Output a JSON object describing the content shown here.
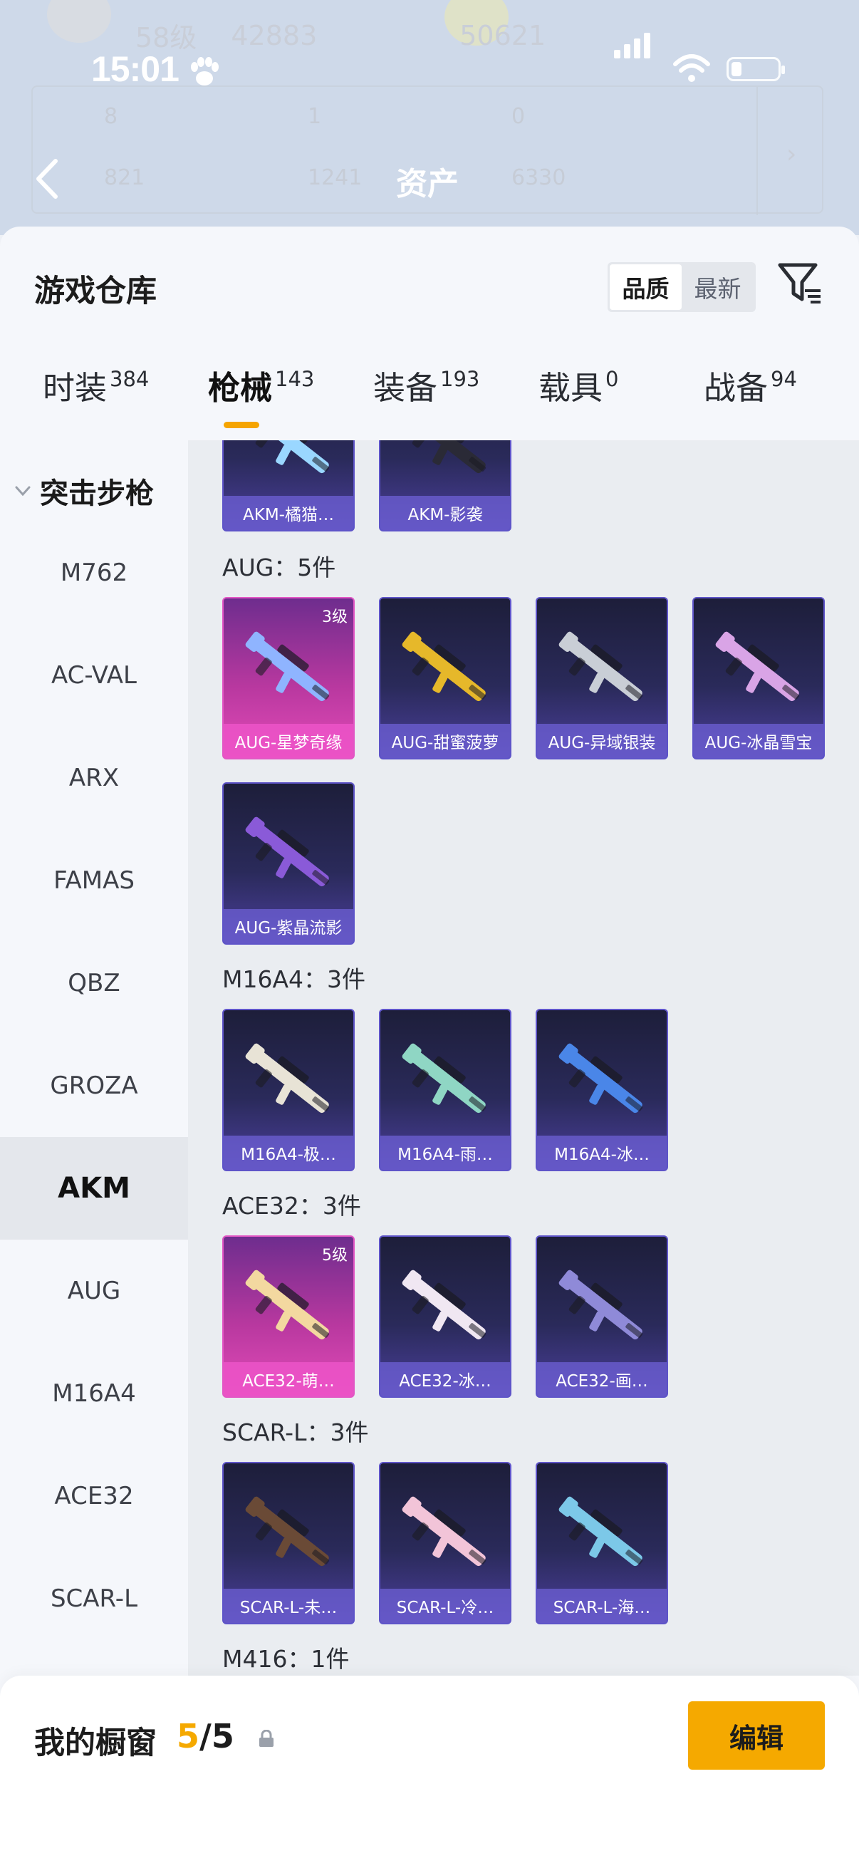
{
  "status_bar": {
    "time": "15:01"
  },
  "background_header": {
    "level": "58级",
    "score_a": "42883",
    "score_b": "50621",
    "stat_1": "8",
    "stat_2": "1",
    "stat_3": "0",
    "stat_4": "821",
    "stat_5": "1241",
    "stat_6": "6330",
    "title": "资产"
  },
  "sheet": {
    "title": "游戏仓库",
    "sort_options": [
      "品质",
      "最新"
    ],
    "sort_active": "品质"
  },
  "tabs": [
    {
      "label": "时装",
      "count": "384"
    },
    {
      "label": "枪械",
      "count": "143"
    },
    {
      "label": "装备",
      "count": "193"
    },
    {
      "label": "载具",
      "count": "0"
    },
    {
      "label": "战备",
      "count": "94"
    }
  ],
  "active_tab": "枪械",
  "category": {
    "group": "突击步枪",
    "items": [
      "M762",
      "AC-VAL",
      "ARX",
      "FAMAS",
      "QBZ",
      "GROZA",
      "AKM",
      "AUG",
      "M16A4",
      "ACE32",
      "SCAR-L"
    ],
    "active": "AKM"
  },
  "content": {
    "partial_row": [
      {
        "name": "AKM-橘猫…",
        "color": "#9ad7ff"
      },
      {
        "name": "AKM-影袭",
        "color": "#2a2a36"
      }
    ],
    "groups": [
      {
        "title": "AUG：5件",
        "items": [
          {
            "name": "AUG-星梦奇缘",
            "level": "3级",
            "pink": true,
            "color": "#8fb4ff"
          },
          {
            "name": "AUG-甜蜜菠萝",
            "color": "#e6b82a"
          },
          {
            "name": "AUG-异域银装",
            "color": "#c9ced6"
          },
          {
            "name": "AUG-冰晶雪宝",
            "color": "#d9a4e6"
          },
          {
            "name": "AUG-紫晶流影",
            "color": "#8a5ad8"
          }
        ]
      },
      {
        "title": "M16A4：3件",
        "items": [
          {
            "name": "M16A4-极…",
            "color": "#e8e3d6"
          },
          {
            "name": "M16A4-雨…",
            "color": "#8fd6c4"
          },
          {
            "name": "M16A4-冰…",
            "color": "#4a86e8"
          }
        ]
      },
      {
        "title": "ACE32：3件",
        "items": [
          {
            "name": "ACE32-萌…",
            "level": "5级",
            "pink": true,
            "color": "#f3d8a0"
          },
          {
            "name": "ACE32-冰…",
            "color": "#f0e7f2"
          },
          {
            "name": "ACE32-画…",
            "color": "#8f8ad8"
          }
        ]
      },
      {
        "title": "SCAR-L：3件",
        "items": [
          {
            "name": "SCAR-L-未…",
            "color": "#6a4a36"
          },
          {
            "name": "SCAR-L-冷…",
            "color": "#f2c4d8"
          },
          {
            "name": "SCAR-L-海…",
            "color": "#7cc8e8"
          }
        ]
      },
      {
        "title": "M416：1件",
        "items": []
      }
    ]
  },
  "bottom": {
    "label": "我的橱窗",
    "current": "5",
    "separator": "/",
    "total": "5",
    "edit_label": "编辑"
  },
  "colors": {
    "accent": "#f5a900",
    "card_purple": "#5e54c8",
    "card_pink": "#e257c4"
  }
}
